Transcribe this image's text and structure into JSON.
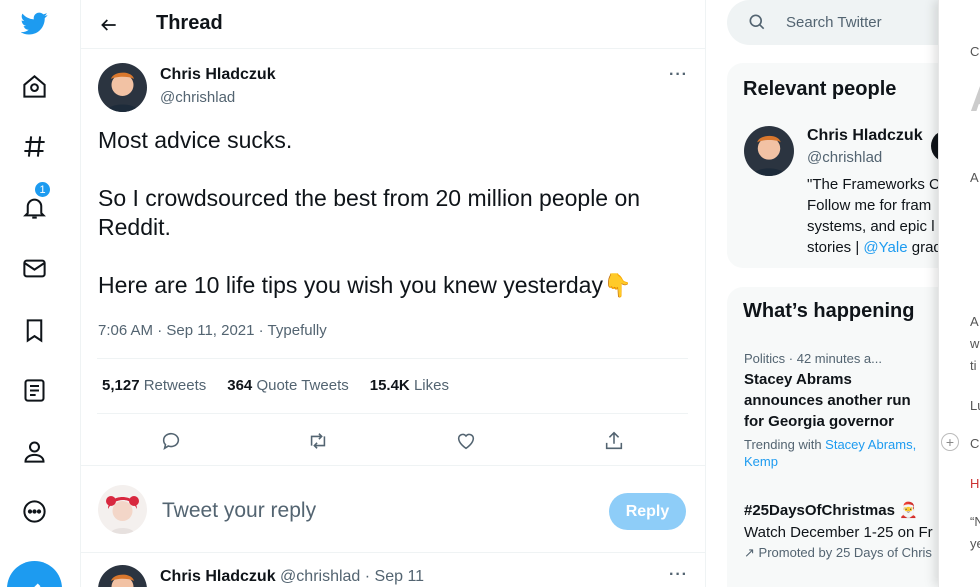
{
  "nav": {
    "items": [
      "twitter-logo",
      "home",
      "explore",
      "notifications",
      "messages",
      "bookmarks",
      "lists",
      "profile",
      "more"
    ],
    "notifications_badge": "1"
  },
  "header": {
    "title": "Thread"
  },
  "tweet": {
    "author_name": "Chris Hladczuk",
    "author_handle": "@chrishlad",
    "more": "···",
    "lines": [
      "Most advice sucks.",
      "So I crowdsourced the best from 20 million people on Reddit.",
      "Here are 10 life tips you wish you knew yesterday👇"
    ],
    "meta": "7:06 AM · Sep 11, 2021 · Typefully",
    "stats": {
      "retweets_count": "5,127",
      "retweets_label": "Retweets",
      "quotes_count": "364",
      "quotes_label": "Quote Tweets",
      "likes_count": "15.4K",
      "likes_label": "Likes"
    }
  },
  "reply": {
    "placeholder": "Tweet your reply",
    "button": "Reply"
  },
  "next_tweet": {
    "name": "Chris Hladczuk",
    "handle": "@chrishlad · Sep 11"
  },
  "search": {
    "placeholder": "Search Twitter"
  },
  "relevant": {
    "title": "Relevant people",
    "name": "Chris Hladczuk",
    "handle": "@chrishlad",
    "bio_lines": [
      "\"The Frameworks C",
      "Follow me for fram",
      "systems, and epic l"
    ],
    "bio_last_prefix": "stories | ",
    "bio_link": "@Yale",
    "bio_last_suffix": " grad"
  },
  "happening": {
    "title": "What’s happening",
    "trend1": {
      "meta": "Politics · 42 minutes a...",
      "title_lines": [
        "Stacey Abrams",
        "announces another run",
        "for Georgia governor"
      ],
      "trending_prefix": "Trending with ",
      "trending_link1": "Stacey Abrams,",
      "trending_link2": "Kemp"
    },
    "trend2": {
      "title": "#25DaysOfChristmas 🎅",
      "subtitle": "Watch December 1-25 on Fr",
      "promoted": "Promoted by 25 Days of Chris"
    }
  },
  "overlay": {
    "texts": [
      "Cl",
      "A",
      "A",
      "A",
      "w",
      "ti",
      "Lu",
      "C",
      "H",
      "“N",
      "ye"
    ]
  },
  "colors": {
    "accent": "#1d9bf0",
    "text": "#0f1419",
    "muted": "#536471"
  }
}
